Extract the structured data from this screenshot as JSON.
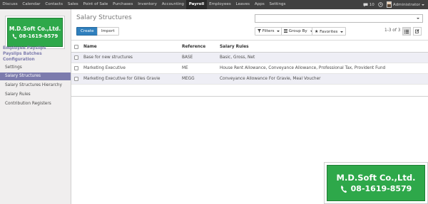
{
  "topbar": {
    "menu": [
      "Discuss",
      "Calendar",
      "Contacts",
      "Sales",
      "Point of Sale",
      "Purchases",
      "Inventory",
      "Accounting",
      "Payroll",
      "Employees",
      "Leaves",
      "Apps",
      "Settings"
    ],
    "active_index": 8,
    "messages_count": "10",
    "user": "Administrator"
  },
  "logo": {
    "company": "M.D.Soft Co.,Ltd.",
    "phone": "08-1619-8579"
  },
  "sidebar": {
    "sections": [
      "Employee Payslips",
      "Payslips Batches",
      "Configuration"
    ],
    "items": [
      "Settings",
      "Salary Structures",
      "Salary Structures Hierarchy",
      "Salary Rules",
      "Contribution Registers"
    ],
    "active_index": 1
  },
  "control": {
    "title": "Salary Structures",
    "create_label": "Create",
    "import_label": "Import",
    "filters_label": "Filters",
    "groupby_label": "Group By",
    "favorites_label": "Favorites",
    "pager": "1-3 of 3"
  },
  "table": {
    "headers": [
      "Name",
      "Reference",
      "Salary Rules"
    ],
    "rows": [
      [
        "Base for new structures",
        "BASE",
        "Basic, Gross, Net"
      ],
      [
        "Marketing Executive",
        "ME",
        "House Rent Allowance, Conveyance Allowance, Professional Tax, Provident Fund"
      ],
      [
        "Marketing Executive for Gilles Gravie",
        "MEGG",
        "Conveyance Allowance For Gravie, Meal Voucher"
      ]
    ]
  },
  "watermark": {
    "company": "M.D.Soft Co.,Ltd.",
    "phone": "08-1619-8579"
  },
  "colors": {
    "navbar": "#414141",
    "accent": "#7c7bad",
    "primary": "#2f7fbd",
    "logo_green": "#2ea84a"
  }
}
